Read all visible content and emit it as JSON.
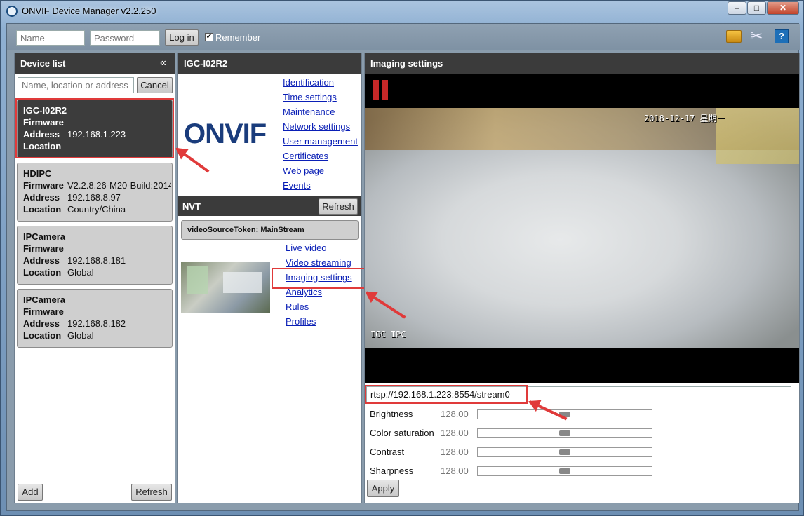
{
  "window": {
    "title": "ONVIF Device Manager v2.2.250",
    "minimize": "–",
    "maximize": "□",
    "close": "✕"
  },
  "login": {
    "name_placeholder": "Name",
    "password_placeholder": "Password",
    "login_label": "Log in",
    "remember_label": "Remember"
  },
  "toolbar_icons": [
    "gold-debug-icon",
    "tools-icon",
    "help-icon"
  ],
  "device_list": {
    "title": "Device list",
    "collapse": "«",
    "search_placeholder": "Name, location or address",
    "cancel_label": "Cancel",
    "add_label": "Add",
    "refresh_label": "Refresh",
    "field_labels": {
      "firmware": "Firmware",
      "address": "Address",
      "location": "Location"
    },
    "devices": [
      {
        "name": "IGC-I02R2",
        "firmware": "",
        "address": "192.168.1.223",
        "location": "",
        "selected": true
      },
      {
        "name": "HDIPC",
        "firmware": "V2.2.8.26-M20-Build:2014",
        "address": "192.168.8.97",
        "location": "Country/China",
        "selected": false
      },
      {
        "name": "IPCamera",
        "firmware": "",
        "address": "192.168.8.181",
        "location": "Global",
        "selected": false
      },
      {
        "name": "IPCamera",
        "firmware": "",
        "address": "192.168.8.182",
        "location": "Global",
        "selected": false
      }
    ]
  },
  "device_panel": {
    "title": "IGC-I02R2",
    "logo_text": "ONVIF",
    "links": [
      "Identification",
      "Time settings",
      "Maintenance",
      "Network settings",
      "User management",
      "Certificates",
      "Web page",
      "Events"
    ],
    "nvt_title": "NVT",
    "nvt_refresh": "Refresh",
    "source_token": "videoSourceToken: MainStream",
    "source_links": [
      "Live video",
      "Video streaming",
      "Imaging settings",
      "Analytics",
      "Rules",
      "Profiles"
    ]
  },
  "imaging": {
    "title": "Imaging settings",
    "osd_time": "2018-12-17 星期一",
    "osd_name": "IGC IPC",
    "rtsp_url": "rtsp://192.168.1.223:8554/stream0",
    "apply_label": "Apply",
    "settings": [
      {
        "label": "Brightness",
        "value": "128.00",
        "fraction": 0.5
      },
      {
        "label": "Color saturation",
        "value": "128.00",
        "fraction": 0.5
      },
      {
        "label": "Contrast",
        "value": "128.00",
        "fraction": 0.5
      },
      {
        "label": "Sharpness",
        "value": "128.00",
        "fraction": 0.5
      }
    ]
  }
}
